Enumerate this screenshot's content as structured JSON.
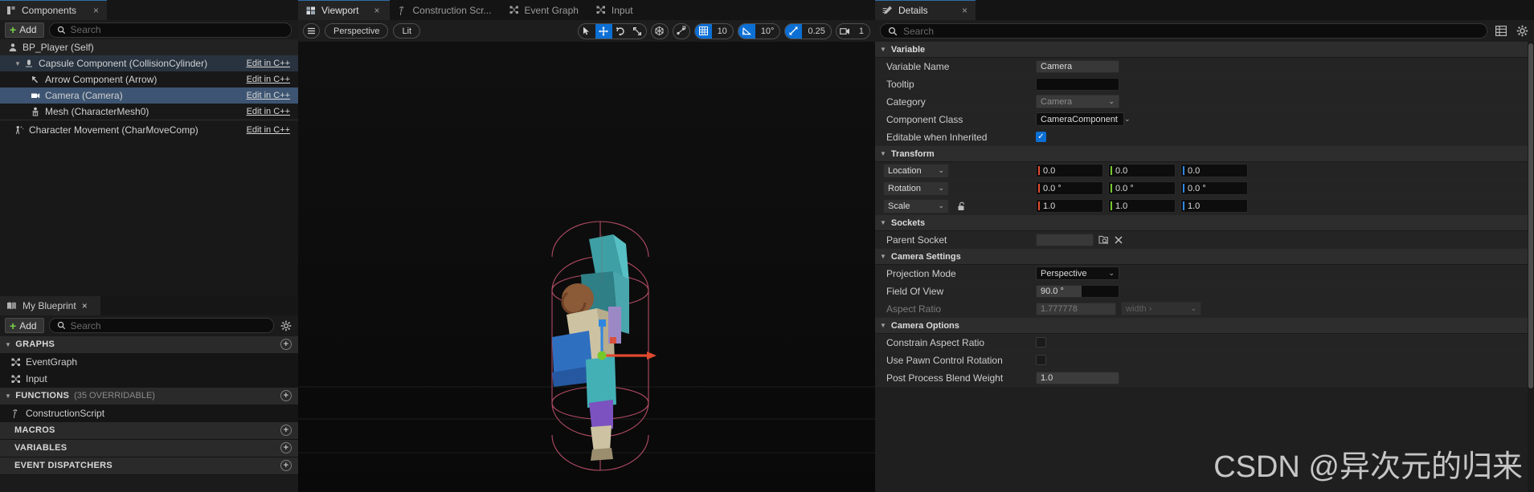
{
  "components_panel": {
    "tab_label": "Components",
    "tab_icon": "components-icon",
    "close_label": "×",
    "add_label": "Add",
    "search_placeholder": "Search",
    "edit_cpp_label": "Edit in C++",
    "tree": [
      {
        "label": "BP_Player (Self)",
        "icon": "pawn-icon",
        "depth": 0,
        "state": "self",
        "cpp": false
      },
      {
        "label": "Capsule Component (CollisionCylinder)",
        "icon": "capsule-icon",
        "depth": 1,
        "state": "lvl1",
        "cpp": true
      },
      {
        "label": "Arrow Component (Arrow)",
        "icon": "arrow-icon",
        "depth": 2,
        "state": "plain",
        "cpp": true
      },
      {
        "label": "Camera (Camera)",
        "icon": "camera-icon",
        "depth": 2,
        "state": "sel",
        "cpp": true
      },
      {
        "label": "Mesh (CharacterMesh0)",
        "icon": "skeletal-mesh-icon",
        "depth": 2,
        "state": "plain",
        "cpp": true
      },
      {
        "label": "Character Movement (CharMoveComp)",
        "icon": "char-movement-icon",
        "depth": 1,
        "state": "plain",
        "cpp": true
      }
    ]
  },
  "my_blueprint_panel": {
    "tab_label": "My Blueprint",
    "tab_icon": "book-icon",
    "close_label": "×",
    "add_label": "Add",
    "search_placeholder": "Search",
    "settings_icon": "gear-icon",
    "sections": [
      {
        "title": "GRAPHS",
        "sub": "",
        "collapsible": true,
        "items": [
          {
            "label": "EventGraph",
            "icon": "graph-icon"
          },
          {
            "label": "Input",
            "icon": "graph-icon"
          }
        ]
      },
      {
        "title": "FUNCTIONS",
        "sub": "(35 OVERRIDABLE)",
        "collapsible": true,
        "items": [
          {
            "label": "ConstructionScript",
            "icon": "function-icon"
          }
        ]
      },
      {
        "title": "MACROS",
        "sub": "",
        "collapsible": false,
        "items": []
      },
      {
        "title": "VARIABLES",
        "sub": "",
        "collapsible": false,
        "items": []
      },
      {
        "title": "EVENT DISPATCHERS",
        "sub": "",
        "collapsible": false,
        "items": []
      }
    ]
  },
  "viewport": {
    "tabs": [
      {
        "label": "Viewport",
        "icon": "viewport-icon",
        "active": true,
        "close": "×"
      },
      {
        "label": "Construction Scr...",
        "icon": "function-icon",
        "active": false,
        "close": ""
      },
      {
        "label": "Event Graph",
        "icon": "graph-icon",
        "active": false,
        "close": ""
      },
      {
        "label": "Input",
        "icon": "graph-icon",
        "active": false,
        "close": ""
      }
    ],
    "toolbar": {
      "menu_icon": "hamburger-icon",
      "view_mode": "Perspective",
      "shading_mode": "Lit",
      "transform_tools": [
        {
          "icon": "select-cursor-icon",
          "active": false
        },
        {
          "icon": "move-gizmo-icon",
          "active": true
        },
        {
          "icon": "rotate-gizmo-icon",
          "active": false
        },
        {
          "icon": "scale-gizmo-icon",
          "active": false
        }
      ],
      "coord_space_icon": "world-space-icon",
      "surface_snap_icon": "surface-snap-icon",
      "grid_snap": {
        "icon": "grid-icon",
        "value": "10",
        "enabled": true
      },
      "angle_snap": {
        "icon": "angle-icon",
        "value": "10°",
        "enabled": true
      },
      "scale_snap": {
        "icon": "scale-snap-icon",
        "value": "0.25",
        "enabled": true
      },
      "camera_speed": {
        "icon": "camera-speed-icon",
        "value": "1",
        "enabled": false
      }
    }
  },
  "details_panel": {
    "tab_label": "Details",
    "tab_icon": "details-icon",
    "close_label": "×",
    "search_placeholder": "Search",
    "column_icon": "columns-icon",
    "settings_icon": "gear-icon",
    "categories": [
      {
        "title": "Variable",
        "rows": [
          {
            "label": "Variable Name",
            "type": "textbox",
            "value": "Camera"
          },
          {
            "label": "Tooltip",
            "type": "textbox-dark",
            "value": ""
          },
          {
            "label": "Category",
            "type": "combo-gray",
            "value": "Camera"
          },
          {
            "label": "Component Class",
            "type": "combo",
            "value": "CameraComponent"
          },
          {
            "label": "Editable when Inherited",
            "type": "checkbox",
            "value": "checked"
          }
        ]
      },
      {
        "title": "Transform",
        "rows": [
          {
            "label": "Location",
            "type": "vector",
            "mode": "Location",
            "x": "0.0",
            "y": "0.0",
            "z": "0.0",
            "lock": false
          },
          {
            "label": "Rotation",
            "type": "vector",
            "mode": "Rotation",
            "x": "0.0 °",
            "y": "0.0 °",
            "z": "0.0 °",
            "lock": false
          },
          {
            "label": "Scale",
            "type": "vector",
            "mode": "Scale",
            "x": "1.0",
            "y": "1.0",
            "z": "1.0",
            "lock": true
          }
        ]
      },
      {
        "title": "Sockets",
        "rows": [
          {
            "label": "Parent Socket",
            "type": "socket",
            "value": "",
            "browse_icon": "browse-icon",
            "clear_icon": "clear-x-icon"
          }
        ]
      },
      {
        "title": "Camera Settings",
        "rows": [
          {
            "label": "Projection Mode",
            "type": "combo",
            "value": "Perspective"
          },
          {
            "label": "Field Of View",
            "type": "slider-value",
            "value": "90.0 °"
          },
          {
            "label": "Aspect Ratio",
            "type": "aspect",
            "value": "1.777778",
            "unit": "width ›",
            "disabled": true
          }
        ]
      },
      {
        "title": "Camera Options",
        "rows": [
          {
            "label": "Constrain Aspect Ratio",
            "type": "checkbox",
            "value": "unchecked"
          },
          {
            "label": "Use Pawn Control Rotation",
            "type": "checkbox",
            "value": "unchecked"
          },
          {
            "label": "Post Process Blend Weight",
            "type": "slider-value",
            "value": "1.0"
          }
        ]
      }
    ]
  },
  "watermark": {
    "text": "CSDN @异次元的归来"
  },
  "colors": {
    "accent_blue": "#0c6fd4",
    "tab_underline": "#2f6ea8",
    "selection": "#3d5572",
    "axis_x": "#e04a2f",
    "axis_y": "#76c82b",
    "axis_z": "#2f86e0",
    "add_plus_green": "#77d24a"
  }
}
